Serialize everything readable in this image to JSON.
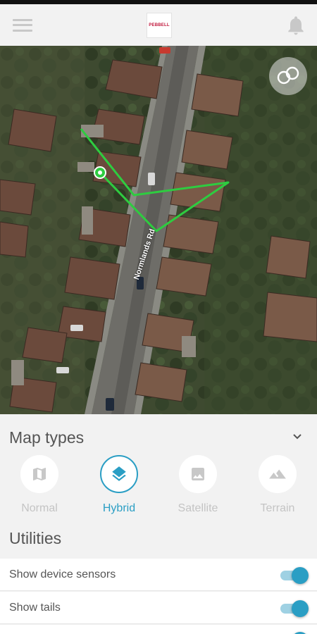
{
  "header": {
    "logo_text": "PEBBELL",
    "menu_icon": "hamburger-menu-icon",
    "notification_icon": "bell-icon"
  },
  "map": {
    "road_label": "Normlands Rd",
    "layers_button_icon": "layers-icon",
    "track_color": "#2ecc40",
    "pin_color": "#2ecc40"
  },
  "panel": {
    "map_types_title": "Map types",
    "map_types": [
      {
        "label": "Normal",
        "icon": "map-icon",
        "selected": false
      },
      {
        "label": "Hybrid",
        "icon": "layers-icon",
        "selected": true
      },
      {
        "label": "Satellite",
        "icon": "image-icon",
        "selected": false
      },
      {
        "label": "Terrain",
        "icon": "mountain-icon",
        "selected": false
      }
    ],
    "utilities_title": "Utilities",
    "utilities": [
      {
        "label": "Show device sensors",
        "enabled": true
      },
      {
        "label": "Show tails",
        "enabled": true
      }
    ]
  },
  "colors": {
    "accent": "#2a9ec4",
    "inactive_text": "#c4c4c4",
    "panel_bg": "#f2f2f2"
  }
}
